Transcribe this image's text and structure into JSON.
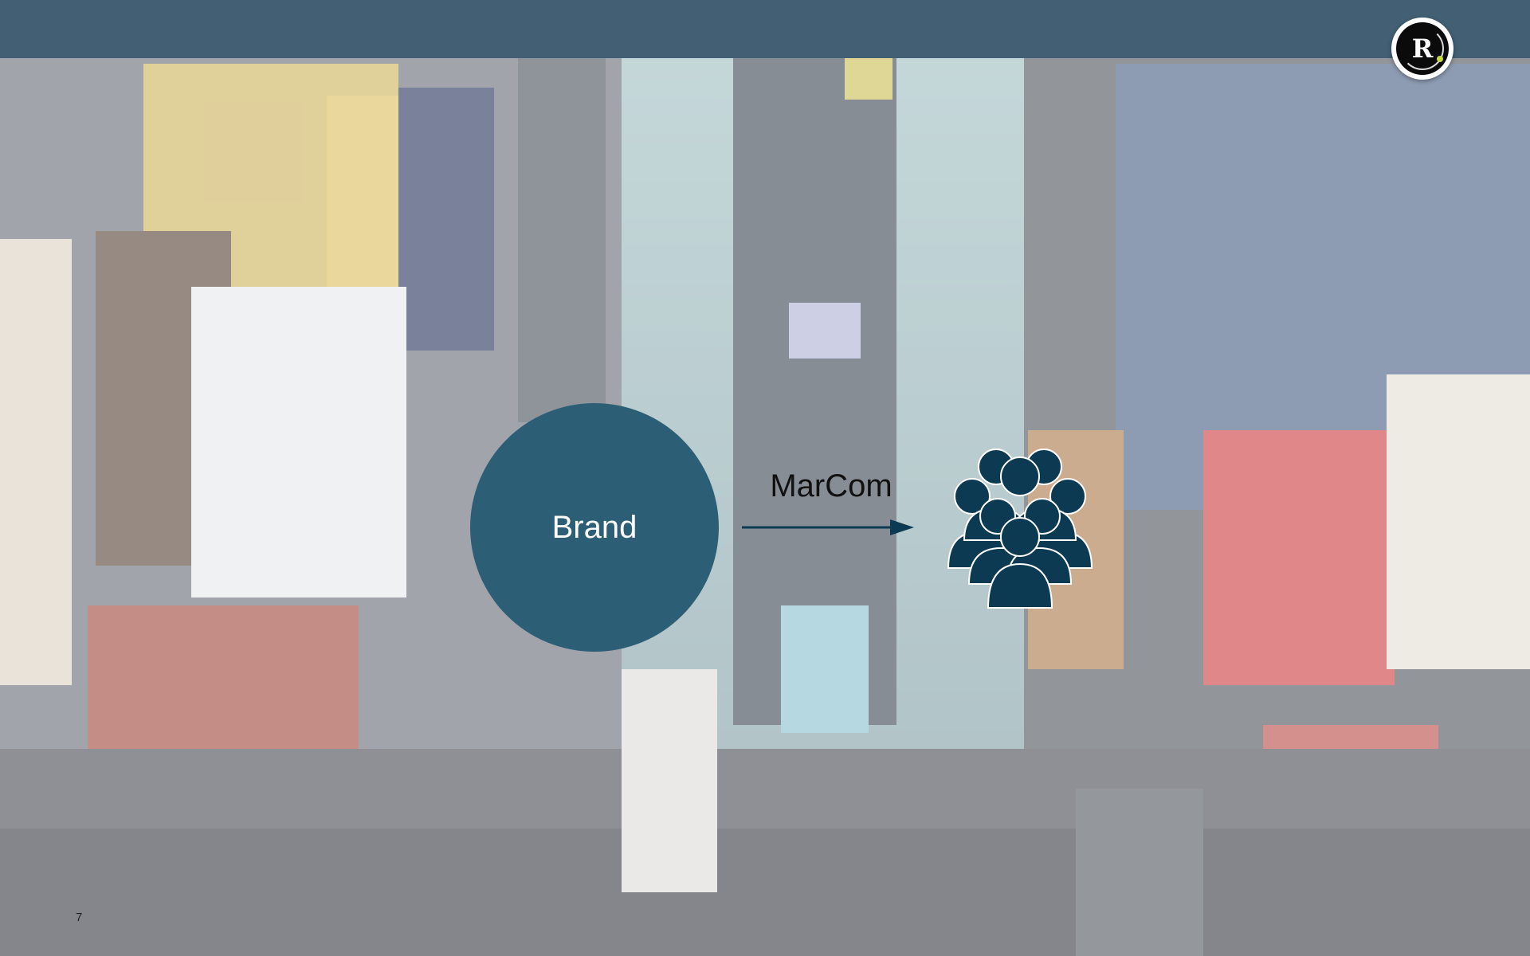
{
  "slide": {
    "center_label": "Brand",
    "arrow_label": "MarCom",
    "page_number": "7"
  },
  "logo": {
    "letter": "R"
  },
  "colors": {
    "header": "#425f73",
    "brand_circle": "#2c5f75",
    "audience_icon": "#0c3a52"
  },
  "icons": [
    "brand-logo-icon",
    "arrow-right-icon",
    "audience-group-icon"
  ]
}
